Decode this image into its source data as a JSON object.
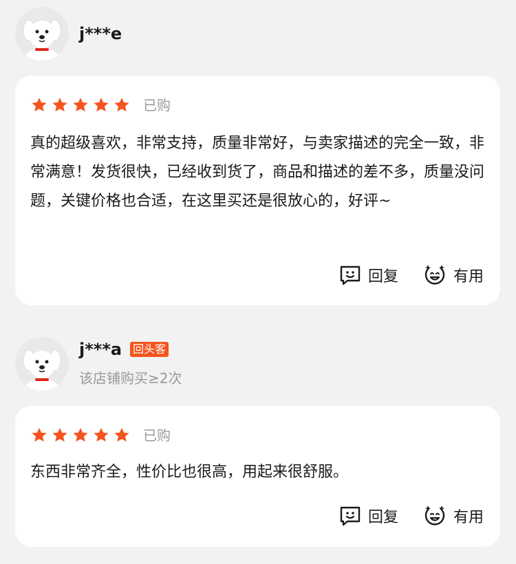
{
  "reviews": [
    {
      "username": "j***e",
      "badge": "",
      "sub": "",
      "stars": 5,
      "purchased": "已购",
      "content": "真的超级喜欢，非常支持，质量非常好，与卖家描述的完全一致，非常满意！发货很快，已经收到货了，商品和描述的差不多，质量没问题，关键价格也合适，在这里买还是很放心的，好评~",
      "reply_label": "回复",
      "helpful_label": "有用"
    },
    {
      "username": "j***a",
      "badge": "回头客",
      "sub": "该店铺购买≥2次",
      "stars": 5,
      "purchased": "已购",
      "content": "东西非常齐全，性价比也很高，用起来很舒服。",
      "reply_label": "回复",
      "helpful_label": "有用"
    }
  ],
  "colors": {
    "star": "#f5541e",
    "badge": "#f5541e",
    "page_bg": "#f2f2f2",
    "card_bg": "#ffffff"
  },
  "icons": {
    "avatar": "dog-mascot-avatar",
    "star": "star-icon",
    "reply": "speech-bubble-face-icon",
    "helpful": "smiling-face-sparkle-icon"
  }
}
